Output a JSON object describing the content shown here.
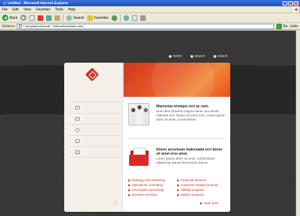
{
  "window": {
    "title": "Untitled - Microsoft Internet Explorer"
  },
  "menubar": {
    "items": [
      "File",
      "Edit",
      "View",
      "Favorites",
      "Tools",
      "Help"
    ]
  },
  "toolbar": {
    "back_label": "Back",
    "search_label": "Search",
    "favorites_label": "Favorites"
  },
  "address": {
    "label": "Address",
    "value": "F:\\templates\\2\\extra5\\...\\WithoutFlash\\index.html",
    "go_label": "Go",
    "links_label": "Links"
  },
  "site": {
    "topnav": [
      "home",
      "search",
      "search"
    ],
    "feature1": {
      "heading": "Maecenas tristique orci ac sem.",
      "body": "Duis ultric pharetra magna donec accumsan malesda orci. Donec sit amet eros. Lorem ipsum dolor sit amet, consectetuer..."
    },
    "feature2": {
      "heading": "Donec accumsan malesuada orci donec sit amet eros amet.",
      "body": "Lorem ipsum dolor sit amet, consectetuer adipiscing mauris fermentum dictum."
    },
    "links_left": [
      "Strategy and marketing",
      "Operations consulting",
      "Information technology",
      "Decision services"
    ],
    "links_right": [
      "Financial services",
      "Customer related services",
      "Affiliate program",
      "Market analytics"
    ],
    "read_more": "read more"
  }
}
